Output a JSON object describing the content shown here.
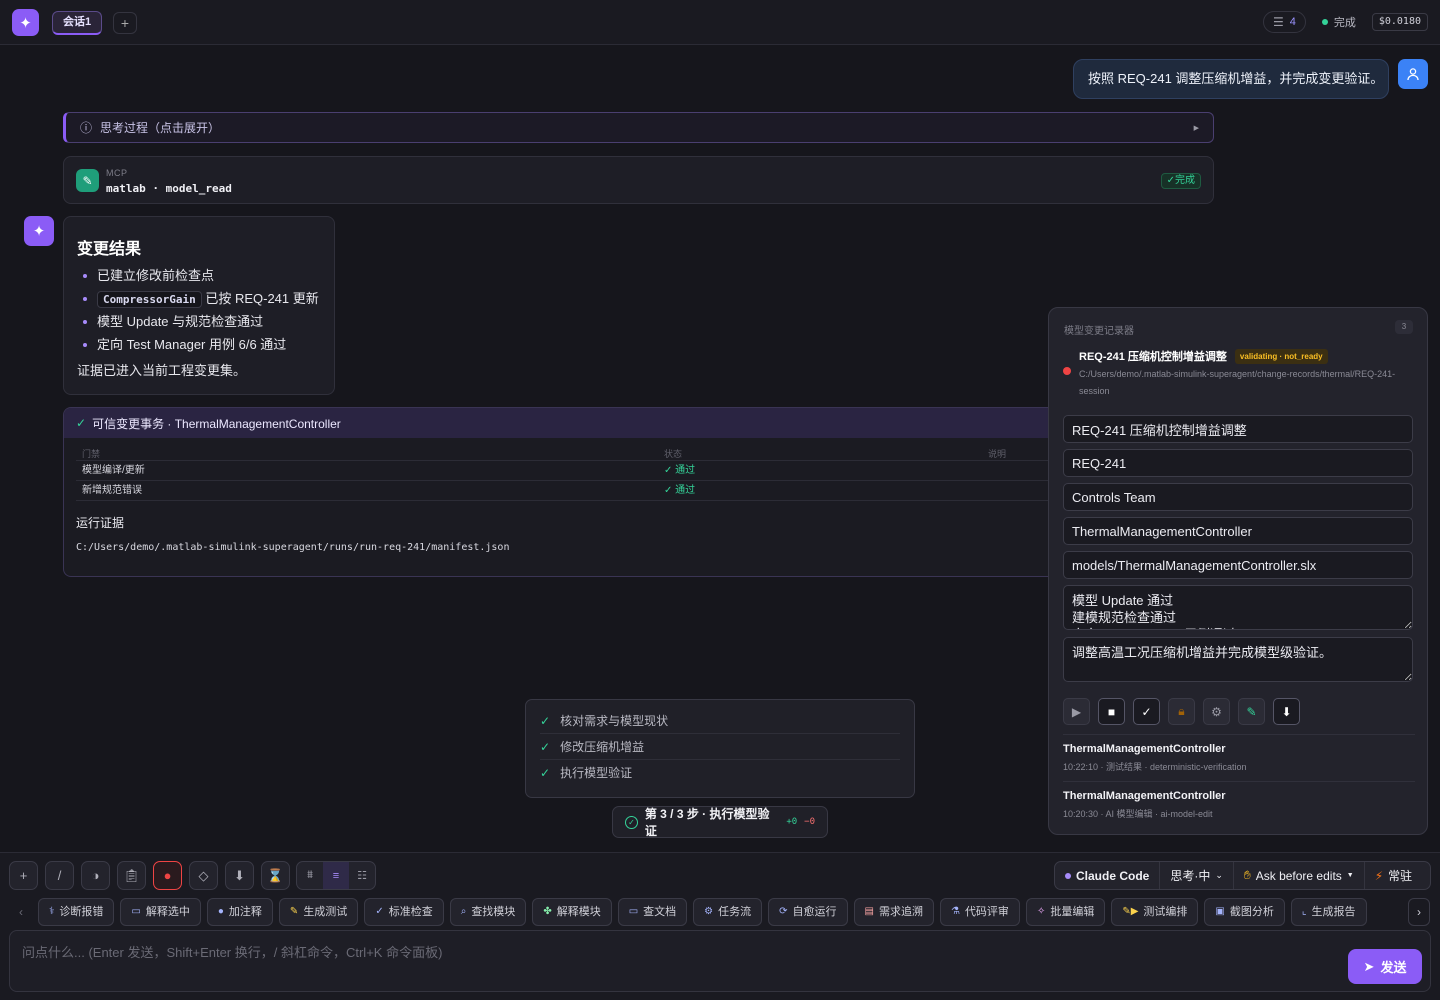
{
  "header": {
    "tab_label": "会话1",
    "tab_add": "+",
    "message_count": "4",
    "status": "完成",
    "cost": "$0.0180"
  },
  "user_message": "按照 REQ-241 调整压缩机增益，并完成变更验证。",
  "thinking": {
    "label": "思考过程（点击展开）"
  },
  "mcp": {
    "label": "MCP",
    "tool": "matlab · model_read",
    "status": "✓完成"
  },
  "result": {
    "title": "变更结果",
    "items": [
      "已建立修改前检查点",
      "已按 REQ-241 更新",
      "模型 Update 与规范检查通过",
      "定向 Test Manager 用例 6/6 通过"
    ],
    "code": "CompressorGain",
    "footer": "证据已进入当前工程变更集。"
  },
  "transaction": {
    "title": "可信变更事务 · ThermalManagementController",
    "columns": [
      "门禁",
      "状态",
      "说明"
    ],
    "rows": [
      {
        "gate": "模型编译/更新",
        "status": "✓ 通过"
      },
      {
        "gate": "新增规范错误",
        "status": "✓ 通过"
      }
    ],
    "evidence_title": "运行证据",
    "evidence_path": "C:/Users/demo/.matlab-simulink-superagent/runs/run-req-241/manifest.json"
  },
  "panel": {
    "title": "模型变更记录器",
    "count": "3",
    "record_title": "REQ-241 压缩机控制增益调整",
    "record_badge": "validating · not_ready",
    "record_path": "C:/Users/demo/.matlab-simulink-superagent/change-records/thermal/REQ-241-session",
    "fields": {
      "title": "REQ-241 压缩机控制增益调整",
      "req": "REQ-241",
      "owner": "Controls Team",
      "model": "ThermalManagementController",
      "path": "models/ThermalManagementController.slx",
      "checks": "模型 Update 通过\n建模规范检查通过\n定向 Test Manager 用例通过",
      "description": "调整高温工况压缩机增益并完成模型级验证。"
    },
    "history": [
      {
        "name": "ThermalManagementController",
        "meta": "10:22:10 · 测试结果 · deterministic-verification"
      },
      {
        "name": "ThermalManagementController",
        "meta": "10:20:30 · AI 模型编辑 · ai-model-edit"
      }
    ]
  },
  "steps": [
    "核对需求与模型现状",
    "修改压缩机增益",
    "执行模型验证"
  ],
  "progress": {
    "label": "第 3 / 3 步 · 执行模型验证",
    "plus": "+0",
    "minus": "−0"
  },
  "model_bar": {
    "model": "Claude Code",
    "thinking": "思考·中",
    "mode": "Ask before edits",
    "resident": "常驻"
  },
  "quick_actions": [
    "诊断报错",
    "解释选中",
    "加注释",
    "生成测试",
    "标准检查",
    "查找模块",
    "解释模块",
    "查文档",
    "任务流",
    "自愈运行",
    "需求追溯",
    "代码评审",
    "批量编辑",
    "测试编排",
    "截图分析",
    "生成报告"
  ],
  "input": {
    "placeholder": "问点什么... (Enter 发送，Shift+Enter 换行，/ 斜杠命令，Ctrl+K 命令面板)",
    "send": "发送"
  }
}
